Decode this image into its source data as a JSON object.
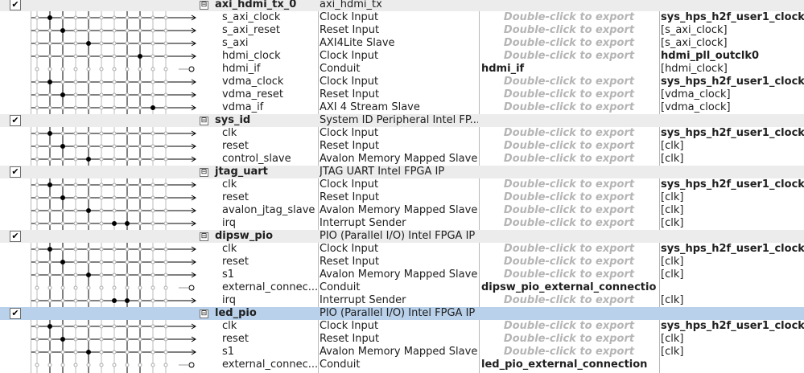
{
  "checkmark": "✔",
  "expander_symbol": "⊟",
  "placeholder_text": "Double-click to export",
  "colors": {
    "module_row": "#ececec",
    "selected_row": "#b9d1ea",
    "placeholder": "#b5b5b5"
  },
  "rows": [
    {
      "kind": "module",
      "name": "axi_hdmi_tx_0",
      "description": "axi_hdmi_tx",
      "export": "",
      "clock": "",
      "checked": true
    },
    {
      "kind": "iface",
      "name": "s_axi_clock",
      "description": "Clock Input",
      "export": "",
      "clock": "sys_hps_h2f_user1_clock",
      "clock_bold": true
    },
    {
      "kind": "iface",
      "name": "s_axi_reset",
      "description": "Reset Input",
      "export": "",
      "clock": "[s_axi_clock]"
    },
    {
      "kind": "iface",
      "name": "s_axi",
      "description": "AXI4Lite Slave",
      "export": "",
      "clock": "[s_axi_clock]"
    },
    {
      "kind": "iface",
      "name": "hdmi_clock",
      "description": "Clock Input",
      "export": "",
      "clock": "hdmi_pll_outclk0",
      "clock_bold": true
    },
    {
      "kind": "iface",
      "name": "hdmi_if",
      "description": "Conduit",
      "export": "hdmi_if",
      "clock": "[hdmi_clock]"
    },
    {
      "kind": "iface",
      "name": "vdma_clock",
      "description": "Clock Input",
      "export": "",
      "clock": "sys_hps_h2f_user1_clock",
      "clock_bold": true
    },
    {
      "kind": "iface",
      "name": "vdma_reset",
      "description": "Reset Input",
      "export": "",
      "clock": "[vdma_clock]"
    },
    {
      "kind": "iface",
      "name": "vdma_if",
      "description": "AXI 4 Stream Slave",
      "export": "",
      "clock": "[vdma_clock]"
    },
    {
      "kind": "module",
      "name": "sys_id",
      "description": "System ID Peripheral Intel FP...",
      "export": "",
      "clock": "",
      "checked": true
    },
    {
      "kind": "iface",
      "name": "clk",
      "description": "Clock Input",
      "export": "",
      "clock": "sys_hps_h2f_user1_clock",
      "clock_bold": true
    },
    {
      "kind": "iface",
      "name": "reset",
      "description": "Reset Input",
      "export": "",
      "clock": "[clk]"
    },
    {
      "kind": "iface",
      "name": "control_slave",
      "description": "Avalon Memory Mapped Slave",
      "export": "",
      "clock": "[clk]"
    },
    {
      "kind": "module",
      "name": "jtag_uart",
      "description": "JTAG UART Intel FPGA IP",
      "export": "",
      "clock": "",
      "checked": true
    },
    {
      "kind": "iface",
      "name": "clk",
      "description": "Clock Input",
      "export": "",
      "clock": "sys_hps_h2f_user1_clock",
      "clock_bold": true
    },
    {
      "kind": "iface",
      "name": "reset",
      "description": "Reset Input",
      "export": "",
      "clock": "[clk]"
    },
    {
      "kind": "iface",
      "name": "avalon_jtag_slave",
      "description": "Avalon Memory Mapped Slave",
      "export": "",
      "clock": "[clk]"
    },
    {
      "kind": "iface",
      "name": "irq",
      "description": "Interrupt Sender",
      "export": "",
      "clock": "[clk]"
    },
    {
      "kind": "module",
      "name": "dipsw_pio",
      "description": "PIO (Parallel I/O) Intel FPGA IP",
      "export": "",
      "clock": "",
      "checked": true
    },
    {
      "kind": "iface",
      "name": "clk",
      "description": "Clock Input",
      "export": "",
      "clock": "sys_hps_h2f_user1_clock",
      "clock_bold": true
    },
    {
      "kind": "iface",
      "name": "reset",
      "description": "Reset Input",
      "export": "",
      "clock": "[clk]"
    },
    {
      "kind": "iface",
      "name": "s1",
      "description": "Avalon Memory Mapped Slave",
      "export": "",
      "clock": "[clk]"
    },
    {
      "kind": "iface",
      "name": "external_connec...",
      "description": "Conduit",
      "export": "dipsw_pio_external_connection",
      "clock": ""
    },
    {
      "kind": "iface",
      "name": "irq",
      "description": "Interrupt Sender",
      "export": "",
      "clock": "[clk]"
    },
    {
      "kind": "module",
      "name": "led_pio",
      "description": "PIO (Parallel I/O) Intel FPGA IP",
      "export": "",
      "clock": "",
      "checked": true,
      "selected": true
    },
    {
      "kind": "iface",
      "name": "clk",
      "description": "Clock Input",
      "export": "",
      "clock": "sys_hps_h2f_user1_clock",
      "clock_bold": true
    },
    {
      "kind": "iface",
      "name": "reset",
      "description": "Reset Input",
      "export": "",
      "clock": "[clk]"
    },
    {
      "kind": "iface",
      "name": "s1",
      "description": "Avalon Memory Mapped Slave",
      "export": "",
      "clock": "[clk]"
    },
    {
      "kind": "iface",
      "name": "external_connec...",
      "description": "Conduit",
      "export": "led_pio_external_connection",
      "clock": ""
    }
  ]
}
